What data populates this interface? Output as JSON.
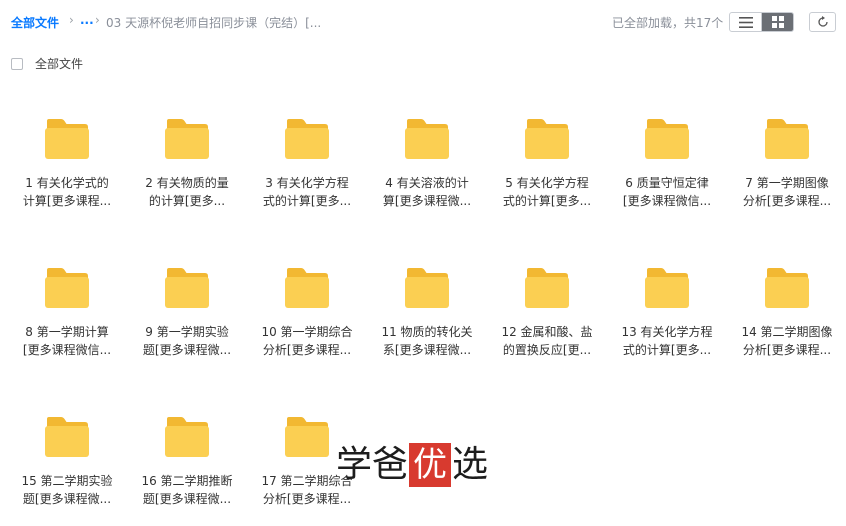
{
  "breadcrumb": {
    "root": "全部文件",
    "ellipsis": "...",
    "current": "03 天源杯倪老师自招同步课（完结）[..."
  },
  "status": "已全部加载，共17个",
  "toolbar": {
    "view_list_icon": "list-view-icon",
    "view_grid_icon": "grid-view-icon",
    "refresh_icon": "refresh-icon"
  },
  "select_all": {
    "label": "全部文件",
    "checked": false
  },
  "folder_color": "#f7c744",
  "items": [
    {
      "line1": "1 有关化学式的",
      "line2": "计算[更多课程..."
    },
    {
      "line1": "2 有关物质的量",
      "line2": "的计算[更多..."
    },
    {
      "line1": "3 有关化学方程",
      "line2": "式的计算[更多..."
    },
    {
      "line1": "4 有关溶液的计",
      "line2": "算[更多课程微..."
    },
    {
      "line1": "5 有关化学方程",
      "line2": "式的计算[更多..."
    },
    {
      "line1": "6 质量守恒定律",
      "line2": "[更多课程微信..."
    },
    {
      "line1": "7 第一学期图像",
      "line2": "分析[更多课程..."
    },
    {
      "line1": "8 第一学期计算",
      "line2": "[更多课程微信..."
    },
    {
      "line1": "9 第一学期实验",
      "line2": "题[更多课程微..."
    },
    {
      "line1": "10 第一学期综合",
      "line2": "分析[更多课程..."
    },
    {
      "line1": "11 物质的转化关",
      "line2": "系[更多课程微..."
    },
    {
      "line1": "12 金属和酸、盐",
      "line2": "的置换反应[更..."
    },
    {
      "line1": "13 有关化学方程",
      "line2": "式的计算[更多..."
    },
    {
      "line1": "14 第二学期图像",
      "line2": "分析[更多课程..."
    },
    {
      "line1": "15 第二学期实验",
      "line2": "题[更多课程微..."
    },
    {
      "line1": "16 第二学期推断",
      "line2": "题[更多课程微..."
    },
    {
      "line1": "17 第二学期综合",
      "line2": "分析[更多课程..."
    }
  ],
  "watermark": {
    "part1": "学爸",
    "highlight": "优",
    "part2": "选",
    "highlight_color": "#d83a2f"
  }
}
